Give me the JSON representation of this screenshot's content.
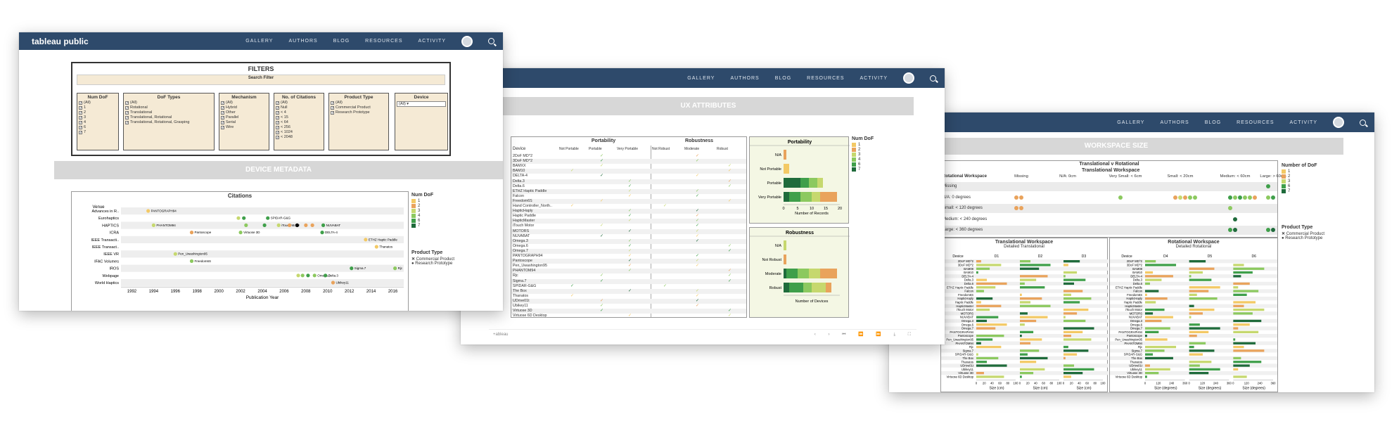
{
  "nav": {
    "logo": "tableau public",
    "logo_partial": "public",
    "logo_partial3": "lic",
    "items": [
      "GALLERY",
      "AUTHORS",
      "BLOG",
      "RESOURCES",
      "ACTIVITY"
    ]
  },
  "colors": {
    "nav": "#2e4a6b",
    "dof1": "#f3c965",
    "dof2": "#e9a35c",
    "dof3": "#c6d86e",
    "dof4": "#8cc95f",
    "dof6": "#3f9f4a",
    "dof7": "#1f6b3b"
  },
  "window1": {
    "filters_title": "FILTERS",
    "search_filter": "Search Filter",
    "num_dof": {
      "title": "Num DoF",
      "options": [
        "(All)",
        "1",
        "2",
        "3",
        "4",
        "6",
        "7"
      ]
    },
    "dof_types": {
      "title": "DoF Types",
      "options": [
        "(All)",
        "Rotational",
        "Translational",
        "Translational, Rotational",
        "Translational, Rotational, Grasping"
      ]
    },
    "mechanism": {
      "title": "Mechanism",
      "options": [
        "(All)",
        "Hybrid",
        "Other",
        "Parallel",
        "Serial",
        "Wire"
      ]
    },
    "citations_filter": {
      "title": "No. of Citations",
      "options": [
        "(All)",
        "Null",
        "< 4",
        "< 15",
        "< 64",
        "< 256",
        "< 1024",
        "< 2048"
      ]
    },
    "product_type": {
      "title": "Product Type",
      "options": [
        "(All)",
        "Commercial Product",
        "Research Prototype"
      ]
    },
    "device": {
      "title": "Device",
      "selected": "(All)"
    },
    "section_title": "DEVICE METADATA",
    "chart_title": "Citations",
    "venue_header": "Venue",
    "venues": [
      "Advances in R..",
      "Eurohaptics",
      "HAPTICS",
      "ICRA",
      "IEEE Transacti..",
      "IEEE Transact..",
      "IEEE VR",
      "IFAC Volumes",
      "IROS",
      "Webpage",
      "World Haptics"
    ],
    "point_labels": [
      "PANTOGRAPH94",
      "SPIDAR-G&G",
      "PHANTOM94",
      "Pantoscope",
      "Virtuose 3D",
      "iTouch Motor",
      "NUVABAT",
      "DELTA-4",
      "ETHZ Haptic Paddle",
      "Thanatos",
      "Pen_Uwashington95",
      "Freedom6S",
      "Sigma.7",
      "Rjc",
      "Omega.3",
      "Delta.3",
      "Ubikey11"
    ],
    "years": [
      "1992",
      "1994",
      "1996",
      "1998",
      "2000",
      "2002",
      "2004",
      "2006",
      "2008",
      "2010",
      "2012",
      "2014",
      "2016"
    ],
    "xlabel": "Publication Year",
    "legend_title": "Num DoF",
    "legend_items": [
      "1",
      "2",
      "3",
      "4",
      "6",
      "7"
    ],
    "product_title": "Product Type",
    "product_items": [
      "Commercial Product",
      "Research Prototype"
    ]
  },
  "window2": {
    "section_title": "UX ATTRIBUTES",
    "device_header": "Device",
    "portability_title": "Portability",
    "robustness_title": "Robustness",
    "port_cols": [
      "Not Portable",
      "Portable",
      "Very Portable"
    ],
    "rob_cols": [
      "Not Robust",
      "Moderate",
      "Robust"
    ],
    "devices": [
      "2DoF MD^2",
      "3DoF MD^2",
      "BAMXX",
      "BAM10",
      "DELTA-4",
      "Delta.3",
      "Delta.6",
      "ETHZ Haptic Paddle",
      "Falcon",
      "Freedom6S",
      "Hand Controller_North..",
      "HapticHaply",
      "Haptic Paddle",
      "HapticMaster",
      "iTouch Motor",
      "MOTORS",
      "NUVABAT",
      "Omega.3",
      "Omega.6",
      "Omega.7",
      "PANTOGRAPH94",
      "Pantoscope",
      "Pen_Uwashington95",
      "PHANTOM94",
      "Rjc",
      "Sigma.7",
      "SPIDAR-G&G",
      "The Box",
      "Thanatos",
      "UDrive01t",
      "Ubikey11",
      "Virtuose 3D",
      "Virtuose 6D Desktop"
    ],
    "bar_port_title": "Portability",
    "bar_port_cats": [
      "N/A",
      "Not Portable",
      "Portable",
      "Very Portable"
    ],
    "bar_port_ticks": [
      "0",
      "5",
      "10",
      "15",
      "20"
    ],
    "bar_port_xlabel": "Number of Records",
    "bar_rob_title": "Robustness",
    "bar_rob_cats": [
      "N/A",
      "Not Robust",
      "Moderate",
      "Robust"
    ],
    "bar_rob_xlabel": "Number of Devices",
    "legend_title": "Num DoF",
    "legend_items": [
      "1",
      "2",
      "3",
      "4",
      "6",
      "7"
    ],
    "footer_logo": "+ableau"
  },
  "window3": {
    "section_title": "WORKSPACE SIZE",
    "matrix_title": "Translational v Rotational",
    "matrix_sub": "Translational Workspace",
    "row_header": "Rotational Workspace",
    "cols": [
      "Missing",
      "N/A: 0cm",
      "Very Small: < 6cm",
      "Small: < 20cm",
      "Medium: < 60cm",
      "Large: > 60cm"
    ],
    "rows": [
      "Missing",
      "N/A: 0 degrees",
      "Small: < 120 degrees",
      "Medium: < 240 degrees",
      "Large: < 360 degrees"
    ],
    "trans_title": "Translational Workspace",
    "trans_sub": "Detailed Translational",
    "rot_title": "Rotational Workspace",
    "rot_sub": "Detailed Rotational",
    "trans_cols": [
      "D1",
      "D2",
      "D3"
    ],
    "rot_cols": [
      "D4",
      "D5",
      "D6"
    ],
    "device_col": "Device",
    "devices": [
      "2DoF MD^2",
      "3DoF MD^2",
      "BAM08",
      "BAM10",
      "DELTA-4",
      "Delta.3",
      "Delta.6",
      "ETHZ Haptic Paddle",
      "Falcon",
      "Freedom6S",
      "HapticHaply",
      "Haptic Paddle",
      "HapticMaster",
      "iTouch Motor",
      "MOTORS",
      "NUVABAT",
      "Omega.3",
      "Omega.6",
      "Omega.7",
      "PANTOGRAPH94",
      "Pantoscope",
      "Pen_Uwashington95",
      "PHANTOM94",
      "Rjc",
      "Sigma.7",
      "SPIDAR-G&G",
      "The Box",
      "Thanatos",
      "UDrive01t",
      "Ubikey11",
      "Virtuose 3D",
      "Virtuose 6D Desktop"
    ],
    "trans_ticks": [
      "0",
      "20",
      "40",
      "60",
      "80",
      "100"
    ],
    "rot_ticks": [
      "0",
      "120",
      "240",
      "360"
    ],
    "trans_xlabel": "Size (cm)",
    "rot_xlabel": "Size (degrees)",
    "legend_title": "Number of DoF",
    "legend_items": [
      "1",
      "2",
      "3",
      "6",
      "7"
    ],
    "product_title": "Product Type",
    "product_items": [
      "Commercial Product",
      "Research Prototype"
    ]
  }
}
